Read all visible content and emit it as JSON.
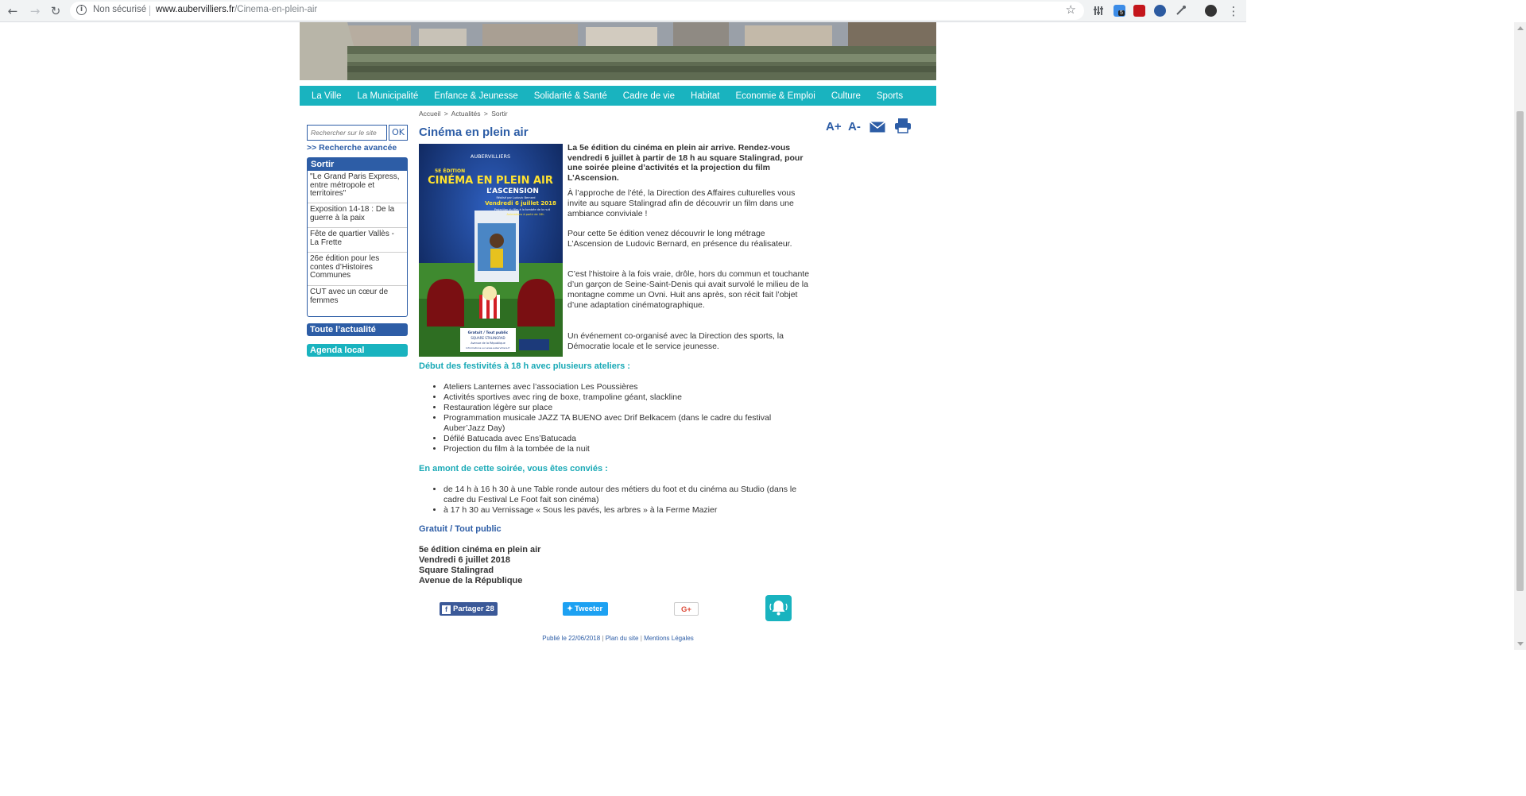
{
  "browser": {
    "security_text": "Non sécurisé",
    "url_domain": "www.aubervilliers.fr",
    "url_path": "/Cinema-en-plein-air",
    "extension_badge": "5"
  },
  "menu": [
    "La Ville",
    "La Municipalité",
    "Enfance & Jeunesse",
    "Solidarité & Santé",
    "Cadre de vie",
    "Habitat",
    "Economie & Emploi",
    "Culture",
    "Sports"
  ],
  "breadcrumb": [
    "Accueil",
    ">",
    "Actualités",
    ">",
    "Sortir"
  ],
  "sidebar": {
    "search_placeholder": "Rechercher sur le site",
    "search_button": "OK",
    "advanced_search": ">> Recherche avancée",
    "sortir_title": "Sortir",
    "sortir_items": [
      "\"Le Grand Paris Express, entre métropole et territoires\"",
      "Exposition 14-18 : De la guerre à la paix",
      "Fête de quartier Vallès - La Frette",
      "26e édition pour les contes d’Histoires Communes",
      "CUT avec un cœur de femmes"
    ],
    "all_news": "Toute l’actualité",
    "agenda": "Agenda local"
  },
  "tools": {
    "font_up": "A+",
    "font_down": "A-"
  },
  "article": {
    "title": "Cinéma en plein air",
    "intro": "La 5e édition du cinéma en plein air arrive. Rendez-vous vendredi 6 juillet à partir de 18 h au square Stalingrad, pour une soirée pleine d’activités et la projection du film L’Ascension.",
    "p1": "À l’approche de l’été, la Direction des Affaires culturelles vous invite au square Stalingrad afin de découvrir un film dans une ambiance conviviale !",
    "p2": "Pour cette 5e édition venez découvrir le long métrage L’Ascension de Ludovic Bernard, en présence du réalisateur.",
    "p3": "C’est l’histoire à la fois vraie, drôle, hors du commun et touchante d’un garçon de Seine-Saint-Denis qui avait survolé le milieu de la montagne comme un Ovni. Huit ans après, son récit fait l’objet d’une adaptation cinématographique.",
    "p4": "Un événement co-organisé avec la Direction des sports, la Démocratie locale et le service jeunesse.",
    "h_ateliers": "Début des festivités à 18 h avec plusieurs ateliers :",
    "ateliers": [
      "Ateliers Lanternes avec l’association Les Poussières",
      "Activités sportives avec ring de boxe, trampoline géant, slackline",
      "Restauration légère sur place",
      "Programmation musicale JAZZ TA BUENO avec Drif Belkacem (dans le cadre du festival Auber’Jazz Day)",
      "Défilé Batucada avec Ens’Batucada",
      "Projection du film à la tombée de la nuit"
    ],
    "h_amont": "En amont de cette soirée, vous êtes conviés :",
    "amont": [
      "de 14 h à 16 h 30 à une Table ronde autour des métiers du foot et du cinéma au Studio (dans le cadre du Festival Le Foot fait son cinéma)",
      "à 17 h 30 au Vernissage « Sous les pavés, les arbres » à la Ferme Mazier"
    ],
    "gratuit": "Gratuit / Tout public",
    "info": [
      "5e édition cinéma en plein air",
      "Vendredi 6 juillet 2018",
      "Square Stalingrad",
      "Avenue de la République"
    ]
  },
  "poster": {
    "city": "AUBERVILLIERS",
    "edition": "5E ÉDITION",
    "headline": "CINÉMA EN PLEIN AIR",
    "film": "L’ASCENSION",
    "director": "Réalisé par Ludovic Bernard",
    "date": "Vendredi 6 juillet 2018",
    "line1": "Projection du film à la tombée de la nuit",
    "line2": "Animations à partir de 18h",
    "free": "Gratuit / Tout public",
    "place": "SQUARE STALINGRAD",
    "avenue": "Avenue de la République",
    "more": "Informations sur www.aubervilliers.fr"
  },
  "share": {
    "facebook": "Partager 28",
    "twitter": "Tweeter",
    "gplus": "G+"
  },
  "footer": {
    "published": "Publié le 22/06/2018",
    "sep": "|",
    "plan": "Plan du site",
    "legal": "Mentions Légales"
  },
  "colors": {
    "teal": "#19b3bf",
    "blue": "#2d5da6",
    "facebook": "#3b5998",
    "twitter": "#1da1f2"
  }
}
